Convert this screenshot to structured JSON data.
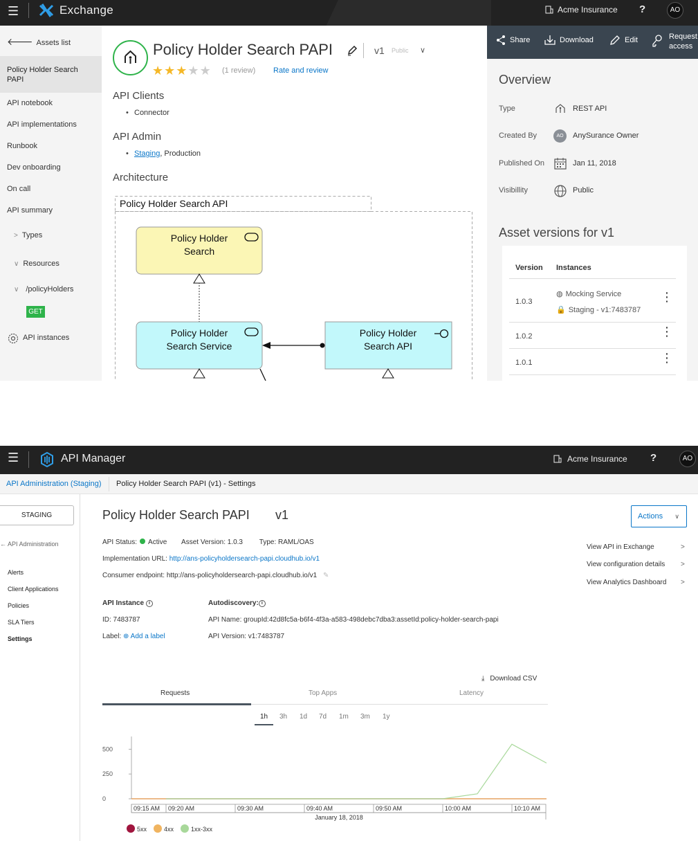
{
  "exchange": {
    "topbar": {
      "app_name": "Exchange",
      "org": "Acme Insurance",
      "help": "?",
      "avatar": "AO"
    },
    "sidebar": {
      "back": "Assets list",
      "active_item": "Policy Holder Search PAPI",
      "items": [
        "API notebook",
        "API implementations",
        "Runbook",
        "Dev onboarding",
        "On call",
        "API summary"
      ],
      "types": "Types",
      "resources": "Resources",
      "resource_path": "/policyHolders",
      "method": "GET",
      "instances": "API instances"
    },
    "asset": {
      "title": "Policy Holder Search PAPI",
      "version": "v1",
      "visibility_tag": "Public",
      "rating": 3,
      "rating_max": 5,
      "reviews": "(1 review)",
      "rate_link": "Rate and review"
    },
    "sections": {
      "clients_heading": "API Clients",
      "clients": [
        "Connector"
      ],
      "admin_heading": "API Admin",
      "admin_link": "Staging",
      "admin_rest": ", Production",
      "architecture_heading": "Architecture"
    },
    "diagram": {
      "group_label": "Policy Holder Search API",
      "nodes": [
        {
          "label_1": "Policy Holder",
          "label_2": "Search",
          "fill": "#fbf6b5"
        },
        {
          "label_1": "Policy Holder",
          "label_2": "Search Service",
          "fill": "#c2f8fb"
        },
        {
          "label_1": "Policy Holder",
          "label_2": "Search API",
          "fill": "#c2f8fb"
        }
      ]
    },
    "actions": [
      "Share",
      "Download",
      "Edit",
      "Request",
      "access"
    ],
    "overview": {
      "heading": "Overview",
      "rows": [
        {
          "label": "Type",
          "value": "REST API"
        },
        {
          "label": "Created By",
          "value": "AnySurance Owner",
          "avatar": "AO"
        },
        {
          "label": "Published On",
          "value": "Jan 11, 2018"
        },
        {
          "label": "Visibillity",
          "value": "Public"
        }
      ]
    },
    "versions": {
      "heading": "Asset versions for v1",
      "col_version": "Version",
      "col_instances": "Instances",
      "rows": [
        {
          "version": "1.0.3",
          "inst_1": "Mocking Service",
          "inst_2": "Staging - v1:7483787"
        },
        {
          "version": "1.0.2"
        },
        {
          "version": "1.0.1"
        }
      ]
    }
  },
  "apim": {
    "topbar": {
      "app_name": "API Manager",
      "org": "Acme Insurance",
      "help": "?",
      "avatar": "AO"
    },
    "breadcrumb": {
      "parent": "API Administration (Staging)",
      "current": "Policy Holder Search PAPI (v1) - Settings"
    },
    "sidebar": {
      "env": "STAGING",
      "back": "← API Administration",
      "items": [
        "Alerts",
        "Client Applications",
        "Policies",
        "SLA Tiers",
        "Settings"
      ]
    },
    "header": {
      "title": "Policy Holder Search PAPI",
      "version": "v1",
      "actions": "Actions"
    },
    "status": {
      "status_label": "API Status:",
      "status_value": "Active",
      "asset_version": "Asset Version: 1.0.3",
      "type": "Type: RAML/OAS",
      "impl_label": "Implementation URL:",
      "impl_url": "http://ans-policyholdersearch-papi.cloudhub.io/v1",
      "consumer_label": "Consumer endpoint:",
      "consumer_url": "http://ans-policyholdersearch-papi.cloudhub.io/v1"
    },
    "links": [
      "View API in Exchange",
      "View configuration details",
      "View Analytics Dashboard"
    ],
    "instance": {
      "heading": "API Instance",
      "id": "ID: 7483787",
      "label_label": "Label:",
      "add_label": "Add a label"
    },
    "autodiscovery": {
      "heading": "Autodiscovery:",
      "api_name": "API Name: groupId:42d8fc5a-b6f4-4f3a-a583-498debc7dba3:assetId:policy-holder-search-papi",
      "api_version": "API Version: v1:7483787"
    },
    "analytics": {
      "download": "Download CSV",
      "tabs": [
        "Requests",
        "Top Apps",
        "Latency"
      ],
      "ranges": [
        "1h",
        "3h",
        "1d",
        "7d",
        "1m",
        "3m",
        "1y"
      ],
      "active_range": "1h"
    }
  },
  "chart_data": {
    "type": "line",
    "x": [
      "09:15 AM",
      "09:20 AM",
      "09:30 AM",
      "09:40 AM",
      "09:50 AM",
      "10:00 AM",
      "10:05 AM",
      "10:10 AM",
      "10:15 AM"
    ],
    "x_ticks": [
      "09:15 AM",
      "09:20 AM",
      "09:30 AM",
      "09:40 AM",
      "09:50 AM",
      "10:00 AM",
      "10:10 AM"
    ],
    "xlabel": "January 18, 2018",
    "y_ticks": [
      500,
      250,
      0
    ],
    "ylim": [
      0,
      600
    ],
    "series": [
      {
        "name": "5xx",
        "color": "#a0153e",
        "values": [
          0,
          0,
          0,
          0,
          0,
          0,
          0,
          0,
          0
        ]
      },
      {
        "name": "4xx",
        "color": "#f0b460",
        "values": [
          0,
          0,
          0,
          0,
          0,
          0,
          0,
          0,
          0
        ]
      },
      {
        "name": "1xx-3xx",
        "color": "#a8d89a",
        "values": [
          null,
          0,
          0,
          0,
          0,
          0,
          50,
          550,
          360
        ]
      }
    ]
  }
}
